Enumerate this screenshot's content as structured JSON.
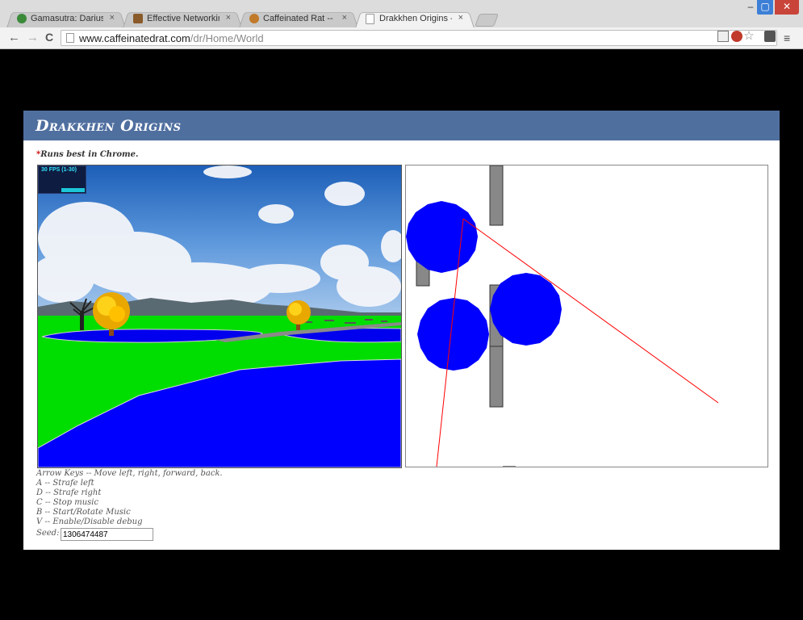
{
  "browser": {
    "tabs": [
      {
        "label": "Gamasutra: Darius Kazemi",
        "close": "×",
        "icon_color": "#3a8a3a"
      },
      {
        "label": "Effective Networking (Get",
        "close": "×",
        "icon_color": "#8a5a2a"
      },
      {
        "label": "Caffeinated Rat -- Edit Exp",
        "close": "×",
        "icon_color": "#c07a2a"
      },
      {
        "label": "Drakkhen Origins -- World",
        "close": "×",
        "icon_color": "#ffffff"
      }
    ],
    "window_controls": {
      "minimize": "–",
      "maximize": "▢",
      "close": "✕"
    },
    "nav": {
      "back": "←",
      "forward": "→",
      "reload": "C"
    },
    "url_host": "www.caffeinatedrat.com",
    "url_path": "/dr/Home/World",
    "menu": "≡",
    "extensions": [
      "extension-icon",
      "abp-icon",
      "bookmark-star-icon",
      "glasses-icon"
    ]
  },
  "page": {
    "title": "Drakkhen Origins",
    "note_star": "*",
    "note": "Runs best in Chrome.",
    "fps_label": "30 FPS (1-30)",
    "fps_level": 0.9,
    "help_lines": [
      "Arrow Keys -- Move left, right, forward, back.",
      "A -- Strafe left",
      "D -- Strafe right",
      "C -- Stop music",
      "B -- Start/Rotate Music",
      "V -- Enable/Disable debug"
    ],
    "seed_label": "Seed:",
    "seed_value": "1306474487"
  },
  "colors": {
    "header_bg": "#4f6f9f",
    "grass": "#00dd00",
    "water": "#0000ff",
    "map_circle": "#0000ff",
    "map_wall": "#888888",
    "map_ray": "#ff0000"
  }
}
